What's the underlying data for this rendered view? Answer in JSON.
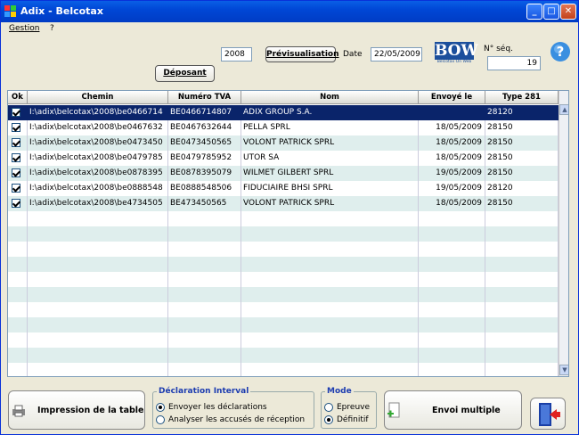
{
  "window": {
    "title": "Adix - Belcotax"
  },
  "menu": {
    "gestion": "Gestion",
    "help": "?"
  },
  "toolbar": {
    "year": "2008",
    "preview": "Prévisualisation",
    "date_label": "Date",
    "date": "22/05/2009",
    "deposant": "Déposant",
    "seq_label": "N° séq.",
    "seq": "19",
    "logo": "BOW",
    "logo_sub": "Belcotax On Web"
  },
  "grid": {
    "headers": {
      "ok": "Ok",
      "chemin": "Chemin",
      "tva": "Numéro TVA",
      "nom": "Nom",
      "envoye": "Envoyé le",
      "type": "Type 281"
    },
    "rows": [
      {
        "chemin": "I:\\adix\\belcotax\\2008\\be0466714",
        "tva": "BE0466714807",
        "nom": "ADIX GROUP S.A.",
        "envoye": "",
        "type": "28120"
      },
      {
        "chemin": "I:\\adix\\belcotax\\2008\\be0467632",
        "tva": "BE0467632644",
        "nom": "PELLA SPRL",
        "envoye": "18/05/2009",
        "type": "28150"
      },
      {
        "chemin": "I:\\adix\\belcotax\\2008\\be0473450",
        "tva": "BE0473450565",
        "nom": "VOLONT PATRICK SPRL",
        "envoye": "18/05/2009",
        "type": "28150"
      },
      {
        "chemin": "I:\\adix\\belcotax\\2008\\be0479785",
        "tva": "BE0479785952",
        "nom": "UTOR SA",
        "envoye": "18/05/2009",
        "type": "28150"
      },
      {
        "chemin": "I:\\adix\\belcotax\\2008\\be0878395",
        "tva": "BE0878395079",
        "nom": "WILMET GILBERT SPRL",
        "envoye": "19/05/2009",
        "type": "28150"
      },
      {
        "chemin": "I:\\adix\\belcotax\\2008\\be0888548",
        "tva": "BE0888548506",
        "nom": "FIDUCIAIRE BHSI SPRL",
        "envoye": "19/05/2009",
        "type": "28120"
      },
      {
        "chemin": "I:\\adix\\belcotax\\2008\\be4734505",
        "tva": "BE473450565",
        "nom": "VOLONT PATRICK SPRL",
        "envoye": "18/05/2009",
        "type": "28150"
      }
    ]
  },
  "bottom": {
    "print": "Impression de la table",
    "decl_title": "Déclaration Interval",
    "decl_send": "Envoyer les déclarations",
    "decl_analyse": "Analyser les accusés de réception",
    "mode_title": "Mode",
    "mode_test": "Epreuve",
    "mode_final": "Définitif",
    "multi": "Envoi multiple"
  },
  "colors": {
    "titlebar": "#0047d6",
    "selected_row": "#0a246a",
    "alt_row": "#dfeeed"
  }
}
